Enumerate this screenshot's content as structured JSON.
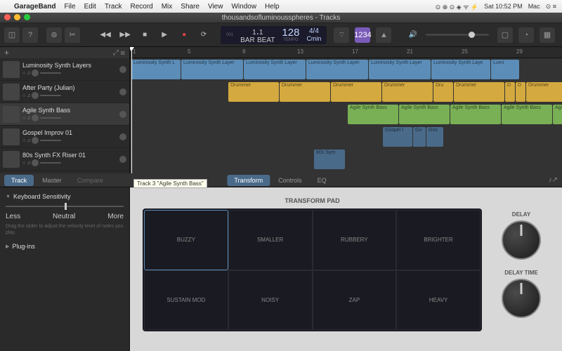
{
  "menubar": {
    "app": "GarageBand",
    "items": [
      "File",
      "Edit",
      "Track",
      "Record",
      "Mix",
      "Share",
      "View",
      "Window",
      "Help"
    ],
    "time": "Sat 10:52 PM",
    "user": "Mac"
  },
  "window": {
    "title": "thousandsofluminousspheres - Tracks"
  },
  "lcd": {
    "bar": "1",
    "beat": "1",
    "bar_label": "BAR",
    "beat_label": "BEAT",
    "tempo": "128",
    "tempo_label": "TEMPO",
    "sig": "4/4",
    "key": "Cmin"
  },
  "display_mode": "1234",
  "ruler": [
    1,
    5,
    9,
    13,
    17,
    21,
    25,
    29
  ],
  "tracks": [
    {
      "name": "Luminosity Synth Layers",
      "icon": "wave"
    },
    {
      "name": "After Party (Julian)",
      "icon": "drum"
    },
    {
      "name": "Agile Synth Bass",
      "icon": "synth",
      "selected": true
    },
    {
      "name": "Gospel Improv 01",
      "icon": "wave"
    },
    {
      "name": "80s Synth FX Riser 01",
      "icon": "wave"
    }
  ],
  "regions": {
    "lumi": [
      "Luminosity Synth L",
      "Luminosity Synth Layer",
      "Luminosity Synth Layer",
      "Luminosity Synth Layer",
      "Luminosity Synth Layer",
      "Luminosity Synth Laye",
      "Lumi"
    ],
    "drum": [
      "Drummer",
      "Drummer",
      "Drummer",
      "Drummer",
      "Dru",
      "Drummer",
      "D",
      "D",
      "Drummer"
    ],
    "bass": [
      "Agile Synth Bass",
      "Agile Synth Bass",
      "Agile Synth Bass",
      "Agile Synth Bass",
      "Agile Synth Bass"
    ],
    "gospel": [
      "Gospel I",
      "Go",
      "Gos"
    ],
    "riser": "80s Synt"
  },
  "editor": {
    "tabs": [
      "Track",
      "Master"
    ],
    "compare": "Compare",
    "subtabs": [
      "Transform",
      "Controls",
      "EQ"
    ],
    "tooltip": "Track 3 \"Agile Synth Bass\"",
    "sensitivity": {
      "title": "Keyboard Sensitivity",
      "less": "Less",
      "neutral": "Neutral",
      "more": "More",
      "desc": "Drag the slider to adjust the velocity level of notes you play."
    },
    "plugins": "Plug-ins",
    "pad_title": "TRANSFORM PAD",
    "pads": [
      "BUZZY",
      "SMALLER",
      "RUBBERY",
      "BRIGHTER",
      "SUSTAIN MOD",
      "NOISY",
      "ZAP",
      "HEAVY"
    ],
    "knobs": [
      {
        "label": "DELAY"
      },
      {
        "label": "DELAY TIME"
      }
    ]
  }
}
